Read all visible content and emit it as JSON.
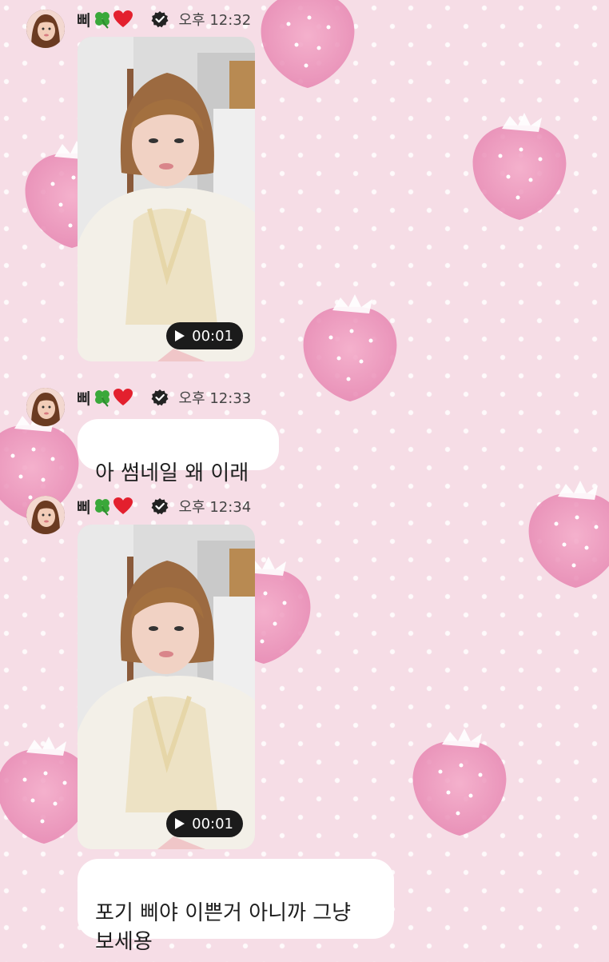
{
  "colors": {
    "background": "#f6dde6",
    "strawberry": "#e98cb4",
    "bubble": "#ffffff",
    "pill": "#1b1b1b"
  },
  "messages": [
    {
      "type": "video",
      "sender": "삐",
      "emojis": [
        "clover-icon",
        "heart-icon"
      ],
      "verified": true,
      "time": "오후 12:32",
      "duration": "00:01"
    },
    {
      "type": "text",
      "sender": "삐",
      "emojis": [
        "clover-icon",
        "heart-icon"
      ],
      "verified": true,
      "time": "오후 12:33",
      "text": "아 썸네일 왜 이래"
    },
    {
      "type": "video",
      "sender": "삐",
      "emojis": [
        "clover-icon",
        "heart-icon"
      ],
      "verified": true,
      "time": "오후 12:34",
      "duration": "00:01"
    },
    {
      "type": "text",
      "text": "포기 삐야 이쁜거 아니까 그냥\n보세용"
    }
  ]
}
